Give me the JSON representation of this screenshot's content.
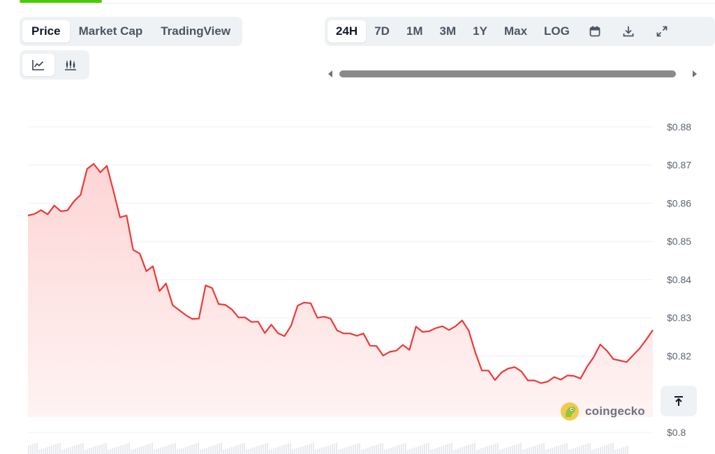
{
  "tabs_left": [
    {
      "label": "Price",
      "active": true
    },
    {
      "label": "Market Cap",
      "active": false
    },
    {
      "label": "TradingView",
      "active": false
    }
  ],
  "tabs_right": [
    {
      "label": "24H",
      "active": true
    },
    {
      "label": "7D",
      "active": false
    },
    {
      "label": "1M",
      "active": false
    },
    {
      "label": "3M",
      "active": false
    },
    {
      "label": "1Y",
      "active": false
    },
    {
      "label": "Max",
      "active": false
    },
    {
      "label": "LOG",
      "active": false
    }
  ],
  "toolbar_icons": [
    "calendar-icon",
    "download-icon",
    "expand-icon"
  ],
  "view_toggle": {
    "active": "line-chart-icon",
    "icons": [
      "line-chart-icon",
      "candlestick-icon"
    ]
  },
  "watermark": {
    "text": "coingecko"
  },
  "colors": {
    "line": "#ef3838",
    "fill_top": "#fdd5d5",
    "fill_bottom": "#fff3f3",
    "accent": "#4bcc00"
  },
  "chart_data": {
    "type": "area",
    "title": "",
    "xlabel": "",
    "ylabel": "",
    "ylim": [
      0.8,
      0.884
    ],
    "ytick_values": [
      0.8,
      0.82,
      0.83,
      0.84,
      0.85,
      0.86,
      0.87,
      0.88
    ],
    "yticks": [
      "$0.8",
      "$0.82",
      "$0.83",
      "$0.84",
      "$0.85",
      "$0.86",
      "$0.87",
      "$0.88"
    ],
    "grid": true,
    "y_axis_position": "right",
    "series": [
      {
        "values": [
          0.8568,
          0.8572,
          0.8582,
          0.8571,
          0.8594,
          0.8579,
          0.8581,
          0.8605,
          0.8622,
          0.869,
          0.8703,
          0.8681,
          0.8698,
          0.8632,
          0.8563,
          0.8568,
          0.8478,
          0.8468,
          0.8422,
          0.8435,
          0.837,
          0.839,
          0.8333,
          0.832,
          0.8307,
          0.8297,
          0.8298,
          0.8385,
          0.8378,
          0.8336,
          0.8334,
          0.8322,
          0.8301,
          0.8301,
          0.8289,
          0.829,
          0.826,
          0.8282,
          0.826,
          0.8252,
          0.8279,
          0.8332,
          0.834,
          0.8338,
          0.83,
          0.8303,
          0.8298,
          0.8267,
          0.8259,
          0.8259,
          0.8253,
          0.8259,
          0.8227,
          0.8226,
          0.8201,
          0.8211,
          0.8214,
          0.8229,
          0.8216,
          0.8277,
          0.8263,
          0.8265,
          0.8273,
          0.8278,
          0.8268,
          0.8278,
          0.8293,
          0.8267,
          0.821,
          0.8162,
          0.8162,
          0.8137,
          0.8157,
          0.8167,
          0.8171,
          0.816,
          0.8136,
          0.8136,
          0.8129,
          0.8133,
          0.8145,
          0.8138,
          0.8149,
          0.8148,
          0.8141,
          0.8172,
          0.8197,
          0.823,
          0.8214,
          0.8192,
          0.8188,
          0.8184,
          0.8202,
          0.822,
          0.8243,
          0.8268
        ]
      }
    ]
  }
}
